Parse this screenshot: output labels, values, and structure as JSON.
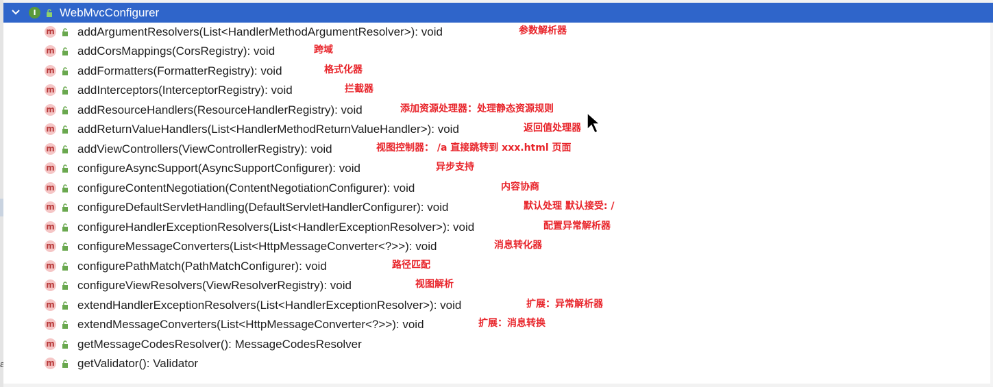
{
  "header": {
    "interface_icon_letter": "I",
    "title": "WebMvcConfigurer"
  },
  "method_icon_letter": "m",
  "gutter_char": "a",
  "colors": {
    "header_bg": "#2f65ca",
    "annotation_red": "#e8242a",
    "method_icon_bg": "#f5c6c6",
    "interface_icon_bg": "#5a9a3b",
    "lock_green": "#6aa84f"
  },
  "methods": [
    {
      "signature": "addArgumentResolvers(List<HandlerMethodArgumentResolver>): void",
      "note": "参数解析器"
    },
    {
      "signature": "addCorsMappings(CorsRegistry): void",
      "note": "跨域"
    },
    {
      "signature": "addFormatters(FormatterRegistry): void",
      "note": "格式化器"
    },
    {
      "signature": "addInterceptors(InterceptorRegistry): void",
      "note": "拦截器"
    },
    {
      "signature": "addResourceHandlers(ResourceHandlerRegistry): void",
      "note": "添加资源处理器：处理静态资源规则"
    },
    {
      "signature": "addReturnValueHandlers(List<HandlerMethodReturnValueHandler>): void",
      "note": "返回值处理器"
    },
    {
      "signature": "addViewControllers(ViewControllerRegistry): void",
      "note": "视图控制器： /a 直接跳转到 xxx.html 页面"
    },
    {
      "signature": "configureAsyncSupport(AsyncSupportConfigurer): void",
      "note": "异步支持"
    },
    {
      "signature": "configureContentNegotiation(ContentNegotiationConfigurer): void",
      "note": "内容协商"
    },
    {
      "signature": "configureDefaultServletHandling(DefaultServletHandlerConfigurer): void",
      "note": "默认处理 默认接受: /"
    },
    {
      "signature": "configureHandlerExceptionResolvers(List<HandlerExceptionResolver>): void",
      "note": "配置异常解析器"
    },
    {
      "signature": "configureMessageConverters(List<HttpMessageConverter<?>>): void",
      "note": "消息转化器"
    },
    {
      "signature": "configurePathMatch(PathMatchConfigurer): void",
      "note": "路径匹配"
    },
    {
      "signature": "configureViewResolvers(ViewResolverRegistry): void",
      "note": "视图解析"
    },
    {
      "signature": "extendHandlerExceptionResolvers(List<HandlerExceptionResolver>): void",
      "note": "扩展：异常解析器"
    },
    {
      "signature": "extendMessageConverters(List<HttpMessageConverter<?>>): void",
      "note": "扩展：消息转换"
    },
    {
      "signature": "getMessageCodesResolver(): MessageCodesResolver",
      "note": ""
    },
    {
      "signature": "getValidator(): Validator",
      "note": ""
    }
  ]
}
